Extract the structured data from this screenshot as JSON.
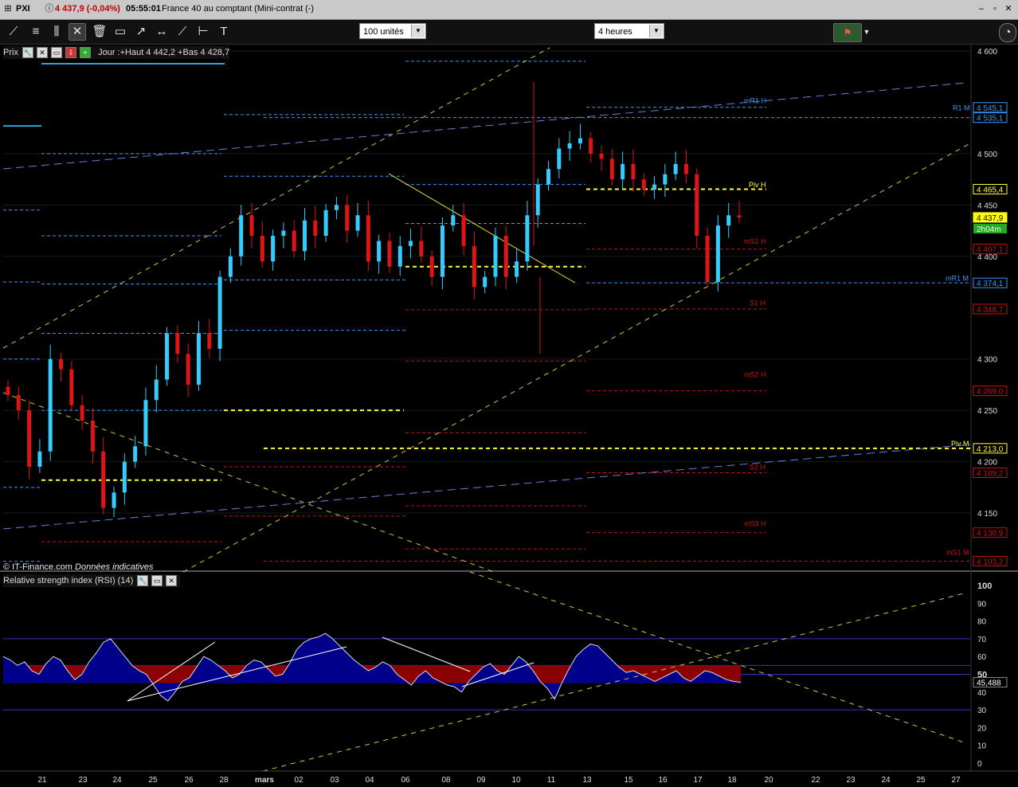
{
  "window": {
    "symbol": "PXI",
    "price_change": "4 437,9 (-0,04%)",
    "time": "05:55:01",
    "instrument": "France 40 au comptant (Mini-contrat",
    "status": "(-)"
  },
  "toolbar": {
    "tools": [
      "line-tool-icon",
      "fibonacci-icon",
      "channel-icon",
      "tools-icon",
      "trash-icon",
      "rectangle-icon",
      "arrow-line-icon",
      "ray-icon",
      "segment-icon",
      "horizontal-line-icon",
      "text-icon"
    ],
    "units_select": "100 unités",
    "period_select": "4 heures"
  },
  "price_panel": {
    "label": "Prix",
    "info": "Jour :+Haut 4 442,2 +Bas 4 428,7",
    "footer": "© IT-Finance.com",
    "footer_italic": "Données indicatives"
  },
  "rsi_panel": {
    "label": "Relative strength index (RSI) (14)"
  },
  "colors": {
    "up": "#33ccff",
    "down": "#e01414",
    "pivot": "#ffff33",
    "resistance": "#3399ff",
    "support": "#cc1111",
    "rsi_fill": "#00008b",
    "rsi_neg": "#8b0000"
  },
  "chart_data": {
    "type": "candlestick",
    "title": "PXI 4 heures",
    "y_axis": {
      "ticks": [
        4600,
        4500,
        4450,
        4400,
        4300,
        4250,
        4200,
        4150
      ],
      "tick_labels": [
        "4 600",
        "4 500",
        "4 450",
        "4 400",
        "4 300",
        "4 250",
        "4 200",
        "4 150"
      ],
      "range": [
        4100,
        4600
      ]
    },
    "x_axis": {
      "labels": [
        "21",
        "23",
        "24",
        "25",
        "26",
        "28",
        "mars",
        "02",
        "03",
        "04",
        "06",
        "08",
        "09",
        "10",
        "11",
        "13",
        "15",
        "16",
        "17",
        "18",
        "20",
        "22",
        "23",
        "24",
        "25",
        "27"
      ]
    },
    "price_tags": [
      {
        "label": "4 545,1",
        "value": 4545.1,
        "color": "#3399ff"
      },
      {
        "label": "4 535,1",
        "value": 4535.1,
        "color": "#3399ff"
      },
      {
        "label": "4 465,4",
        "value": 4465.4,
        "color": "#ffff33"
      },
      {
        "label": "4 437,9",
        "value": 4437.9,
        "color": "#ffff33"
      },
      {
        "label": "4 407,1",
        "value": 4407.1,
        "color": "#cc1111"
      },
      {
        "label": "4 374,1",
        "value": 4374.1,
        "color": "#3399ff"
      },
      {
        "label": "4 348,7",
        "value": 4348.7,
        "color": "#cc1111"
      },
      {
        "label": "4 269,0",
        "value": 4269.0,
        "color": "#cc1111"
      },
      {
        "label": "4 213,0",
        "value": 4213.0,
        "color": "#ffff33"
      },
      {
        "label": "4 189,2",
        "value": 4189.2,
        "color": "#cc1111"
      },
      {
        "label": "4 130,9",
        "value": 4130.9,
        "color": "#cc1111"
      },
      {
        "label": "4 103,2",
        "value": 4103.2,
        "color": "#cc1111"
      }
    ],
    "countdown": "2h04m",
    "levels": [
      {
        "label": "mR1 H",
        "value": 4547
      },
      {
        "label": "R1 M",
        "value": 4540
      },
      {
        "label": "Piv H",
        "value": 4465
      },
      {
        "label": "mS1 H",
        "value": 4410
      },
      {
        "label": "mR1 M",
        "value": 4374
      },
      {
        "label": "S1 H",
        "value": 4350
      },
      {
        "label": "mS2 H",
        "value": 4280
      },
      {
        "label": "Piv M",
        "value": 4213
      },
      {
        "label": "S2 H",
        "value": 4190
      },
      {
        "label": "mS3 H",
        "value": 4135
      },
      {
        "label": "mS1 M",
        "value": 4107
      }
    ],
    "close_series": [
      4265,
      4250,
      4195,
      4210,
      4300,
      4290,
      4255,
      4240,
      4210,
      4155,
      4170,
      4200,
      4215,
      4260,
      4280,
      4325,
      4305,
      4275,
      4325,
      4310,
      4380,
      4400,
      4440,
      4420,
      4395,
      4420,
      4425,
      4405,
      4435,
      4420,
      4445,
      4450,
      4425,
      4440,
      4395,
      4415,
      4390,
      4410,
      4415,
      4400,
      4380,
      4430,
      4440,
      4410,
      4370,
      4380,
      4420,
      4380,
      4395,
      4440,
      4470,
      4485,
      4505,
      4510,
      4515,
      4500,
      4495,
      4475,
      4490,
      4475,
      4465,
      4470,
      4480,
      4490,
      4480,
      4420,
      4375,
      4430,
      4440,
      4437.9
    ],
    "rsi": {
      "levels": [
        30,
        50,
        55,
        70
      ],
      "current": "45,488",
      "tick_labels": [
        "100",
        "90",
        "80",
        "70",
        "60",
        "50",
        "40",
        "30",
        "20",
        "10",
        "0"
      ],
      "values": [
        60,
        58,
        55,
        57,
        52,
        50,
        56,
        60,
        58,
        52,
        47,
        50,
        57,
        62,
        68,
        70,
        65,
        60,
        55,
        52,
        50,
        44,
        38,
        35,
        40,
        46,
        48,
        54,
        60,
        58,
        55,
        52,
        48,
        50,
        55,
        58,
        57,
        53,
        49,
        50,
        56,
        64,
        68,
        70,
        71,
        73,
        70,
        66,
        62,
        58,
        55,
        52,
        54,
        57,
        55,
        50,
        47,
        44,
        49,
        52,
        48,
        46,
        44,
        43,
        40,
        46,
        50,
        54,
        56,
        52,
        50,
        55,
        60,
        57,
        52,
        46,
        42,
        36,
        45,
        53,
        60,
        64,
        67,
        66,
        62,
        58,
        54,
        51,
        52,
        50,
        48,
        46,
        48,
        50,
        52,
        48,
        46,
        49,
        52,
        51,
        49,
        47,
        46,
        45.5
      ]
    }
  }
}
